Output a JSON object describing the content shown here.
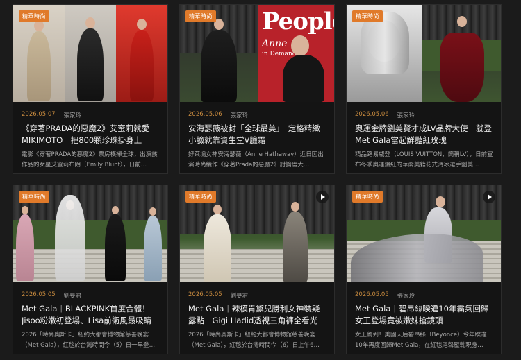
{
  "badge_label": "精華時尚",
  "cards": [
    {
      "date": "2026.05.07",
      "author": "張家玲",
      "title": "《穿著PRADA的惡魔2》艾蜜莉就愛MIKIMOTO　把800顆珍珠掛身上",
      "desc": "電影《穿著PRADA的惡魔2》票房橫掃全球，出演該作品的女星艾蜜莉布朗（Emily Blunt），日前…",
      "has_video": false
    },
    {
      "date": "2026.05.06",
      "author": "張家玲",
      "title": "安海瑟薇被封「全球最美」　定格精緻小臉就靠資生堂V臉霜",
      "desc": "好萊塢女神安海瑟薇（Anne Hathaway）近日因出演時尚續作《穿著Prada的惡魔2》討論度大…",
      "has_video": false,
      "magazine": {
        "logo": "People",
        "name": "Anne",
        "sub": "in Demand"
      }
    },
    {
      "date": "2026.05.06",
      "author": "張家玲",
      "title": "奧運金牌劉美賢才成LV品牌大使　就登Met Gala當起鮮豔紅玫瑰",
      "desc": "精品路易威登（LOUIS VUITTON，簡稱LV），日前宣布冬季奧運爆紅的華裔美籍花式滑冰選手劉美…",
      "has_video": false
    },
    {
      "date": "2026.05.05",
      "author": "劉旻君",
      "title": "Met Gala｜BLACKPINK首度合體！Jisoo粉嫩初登場、Lisa前衛風最吸睛",
      "desc": "2026「時尚奧斯卡」紐約大都會博物館慈善晚宴（Met Gala），紅毯於台灣時間今（5）日一早登…",
      "has_video": true
    },
    {
      "date": "2026.05.05",
      "author": "劉旻君",
      "title": "Met Gala｜辣模肯黛兒勝利女神裝疑露點　Gigi Hadid透視三角褲全看光",
      "desc": "2026「時尚奧斯卡」紐約大都會博物館慈善晚宴（Met Gala），紅毯於台灣時間今（6）日上午6…",
      "has_video": true
    },
    {
      "date": "2026.05.05",
      "author": "張家玲",
      "title": "Met Gala｜碧昂絲睽違10年霸氣回歸　女王登場竟被嫩妹搶鏡頭",
      "desc": "女王駕到！美國天后碧昂絲（Beyonce）今年睽違10年再度回歸Met Gala，在紅毯尾聲壓軸現身…",
      "has_video": true
    }
  ]
}
